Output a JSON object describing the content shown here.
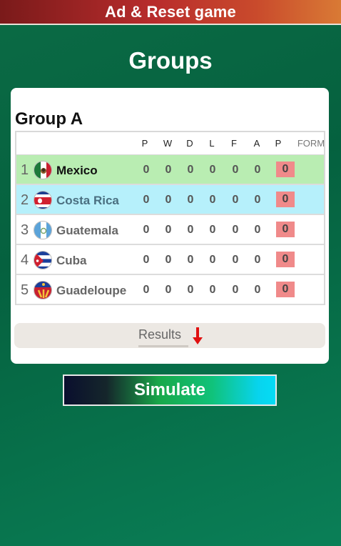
{
  "topbar": {
    "label": "Ad & Reset game"
  },
  "page": {
    "title": "Groups"
  },
  "group": {
    "title": "Group A",
    "headers": [
      "P",
      "W",
      "D",
      "L",
      "F",
      "A",
      "P",
      "FORM"
    ],
    "teams": [
      {
        "rank": "1",
        "name": "Mexico",
        "stats": [
          "0",
          "0",
          "0",
          "0",
          "0",
          "0"
        ],
        "points": "0"
      },
      {
        "rank": "2",
        "name": "Costa Rica",
        "stats": [
          "0",
          "0",
          "0",
          "0",
          "0",
          "0"
        ],
        "points": "0"
      },
      {
        "rank": "3",
        "name": "Guatemala",
        "stats": [
          "0",
          "0",
          "0",
          "0",
          "0",
          "0"
        ],
        "points": "0"
      },
      {
        "rank": "4",
        "name": "Cuba",
        "stats": [
          "0",
          "0",
          "0",
          "0",
          "0",
          "0"
        ],
        "points": "0"
      },
      {
        "rank": "5",
        "name": "Guadeloupe",
        "stats": [
          "0",
          "0",
          "0",
          "0",
          "0",
          "0"
        ],
        "points": "0"
      }
    ]
  },
  "results": {
    "label": "Results",
    "icon": "red-down-arrow-icon"
  },
  "simulate": {
    "label": "Simulate"
  },
  "colors": {
    "leader_row": "#b9edb2",
    "second_row": "#b6f0fb",
    "points_badge": "#f08a8a"
  }
}
